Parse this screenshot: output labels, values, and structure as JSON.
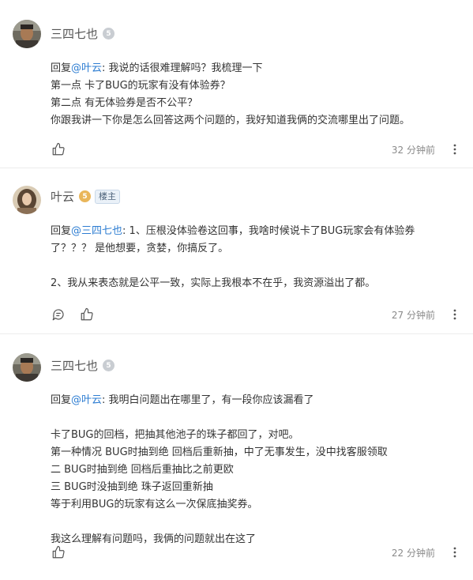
{
  "comments": [
    {
      "username": "三四七也",
      "level_glyph": "5",
      "reply_prefix": "回复",
      "mention": "@叶云",
      "colon": ": ",
      "lines": [
        "我说的话很难理解吗？我梳理一下",
        "第一点 卡了BUG的玩家有没有体验券？",
        "第二点 有无体验券是否不公平？",
        "你跟我讲一下你是怎么回答这两个问题的，我好知道我俩的交流哪里出了问题。"
      ],
      "time": "32 分钟前",
      "icons": [
        "thumbs-up-icon",
        "more-vertical-icon"
      ]
    },
    {
      "username": "叶云",
      "level_glyph": "5",
      "owner_badge": "楼主",
      "reply_prefix": "回复",
      "mention": "@三四七也",
      "colon": ": ",
      "lines": [
        "1、压根没体验卷这回事，我啥时候说卡了BUG玩家会有体验券",
        "了？？？ 是他想要，贪婪，你搞反了。",
        "",
        "2、我从来表态就是公平一致，实际上我根本不在乎，我资源溢出了都。"
      ],
      "time": "27 分钟前",
      "icons": [
        "reply-icon",
        "thumbs-up-icon"
      ]
    },
    {
      "username": "三四七也",
      "level_glyph": "5",
      "reply_prefix": "回复",
      "mention": "@叶云",
      "colon": ": ",
      "lines": [
        "我明白问题出在哪里了，有一段你应该漏看了",
        "",
        "卡了BUG的回档，把抽其他池子的珠子都回了，对吧。",
        "第一种情况 BUG时抽到绝 回档后重新抽，中了无事发生，没中找客服领取",
        "二 BUG时抽到绝 回档后重抽比之前更欧",
        "三 BUG时没抽到绝 珠子返回重新抽",
        "等于利用BUG的玩家有这么一次保底抽奖券。",
        "",
        "我这么理解有问题吗，我俩的问题就出在这了"
      ],
      "time": "22 分钟前",
      "icons": [
        "thumbs-up-icon",
        "more-vertical-icon"
      ]
    }
  ],
  "colors": {
    "mention": "#2d7dd2",
    "owner_badge_bg": "#eaf1f8",
    "level_grey": "#c9cdd2",
    "level_gold": "#e9b65a"
  }
}
